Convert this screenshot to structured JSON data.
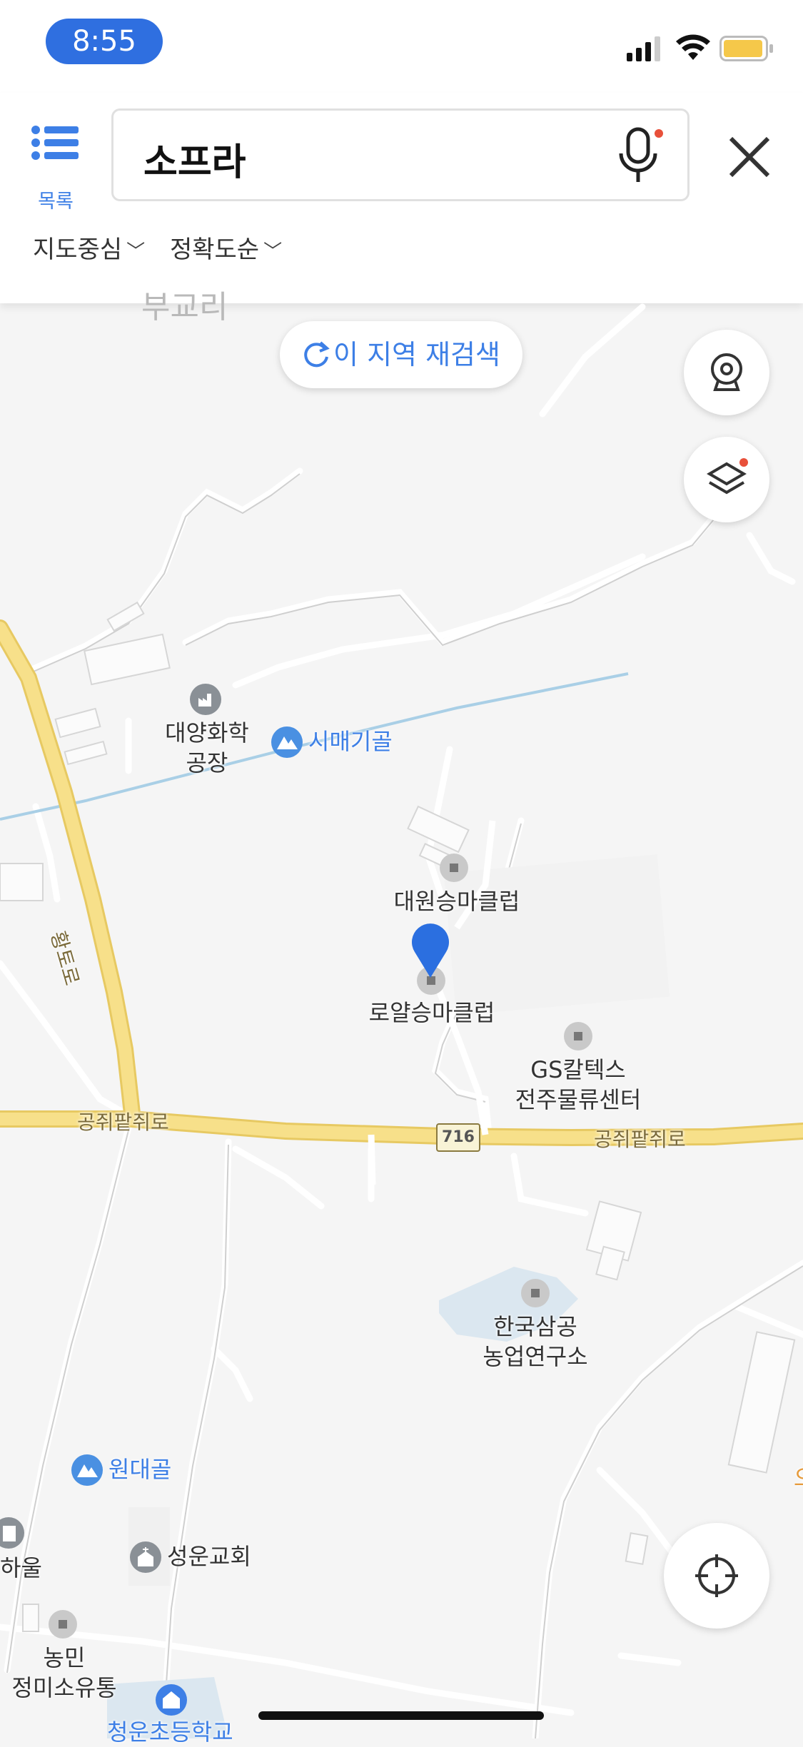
{
  "status_bar": {
    "time": "8:55"
  },
  "header": {
    "menu_label": "목록",
    "search_value": "소프라",
    "filters": [
      "지도중심",
      "정확도순"
    ]
  },
  "map": {
    "rescan_label": "이 지역 재검색",
    "top_place": "부교리",
    "places": {
      "daeyang": [
        "대양화학",
        "공장"
      ],
      "simaegigol": "시매기골",
      "daewon": "대원승마클럽",
      "royal": "로얄승마클럽",
      "gs": [
        "GS칼텍스",
        "전주물류센터"
      ],
      "hanguk": [
        "한국삼공",
        "농업연구소"
      ],
      "wondaegol": "원대골",
      "seongun": "성운교회",
      "nongmin": [
        "농민",
        "정미소유통"
      ],
      "school": "청운초등학교",
      "left_edge": "하울",
      "right_edge": "오"
    },
    "roads": {
      "hwangto": "황토로",
      "gongjwi_left": "공쥐팥쥐로",
      "gongjwi_right": "공쥐팥쥐로",
      "route": "716"
    }
  },
  "colors": {
    "accent": "#3d7fe6",
    "pin": "#2b6fe0",
    "road": "#f7e08a"
  }
}
